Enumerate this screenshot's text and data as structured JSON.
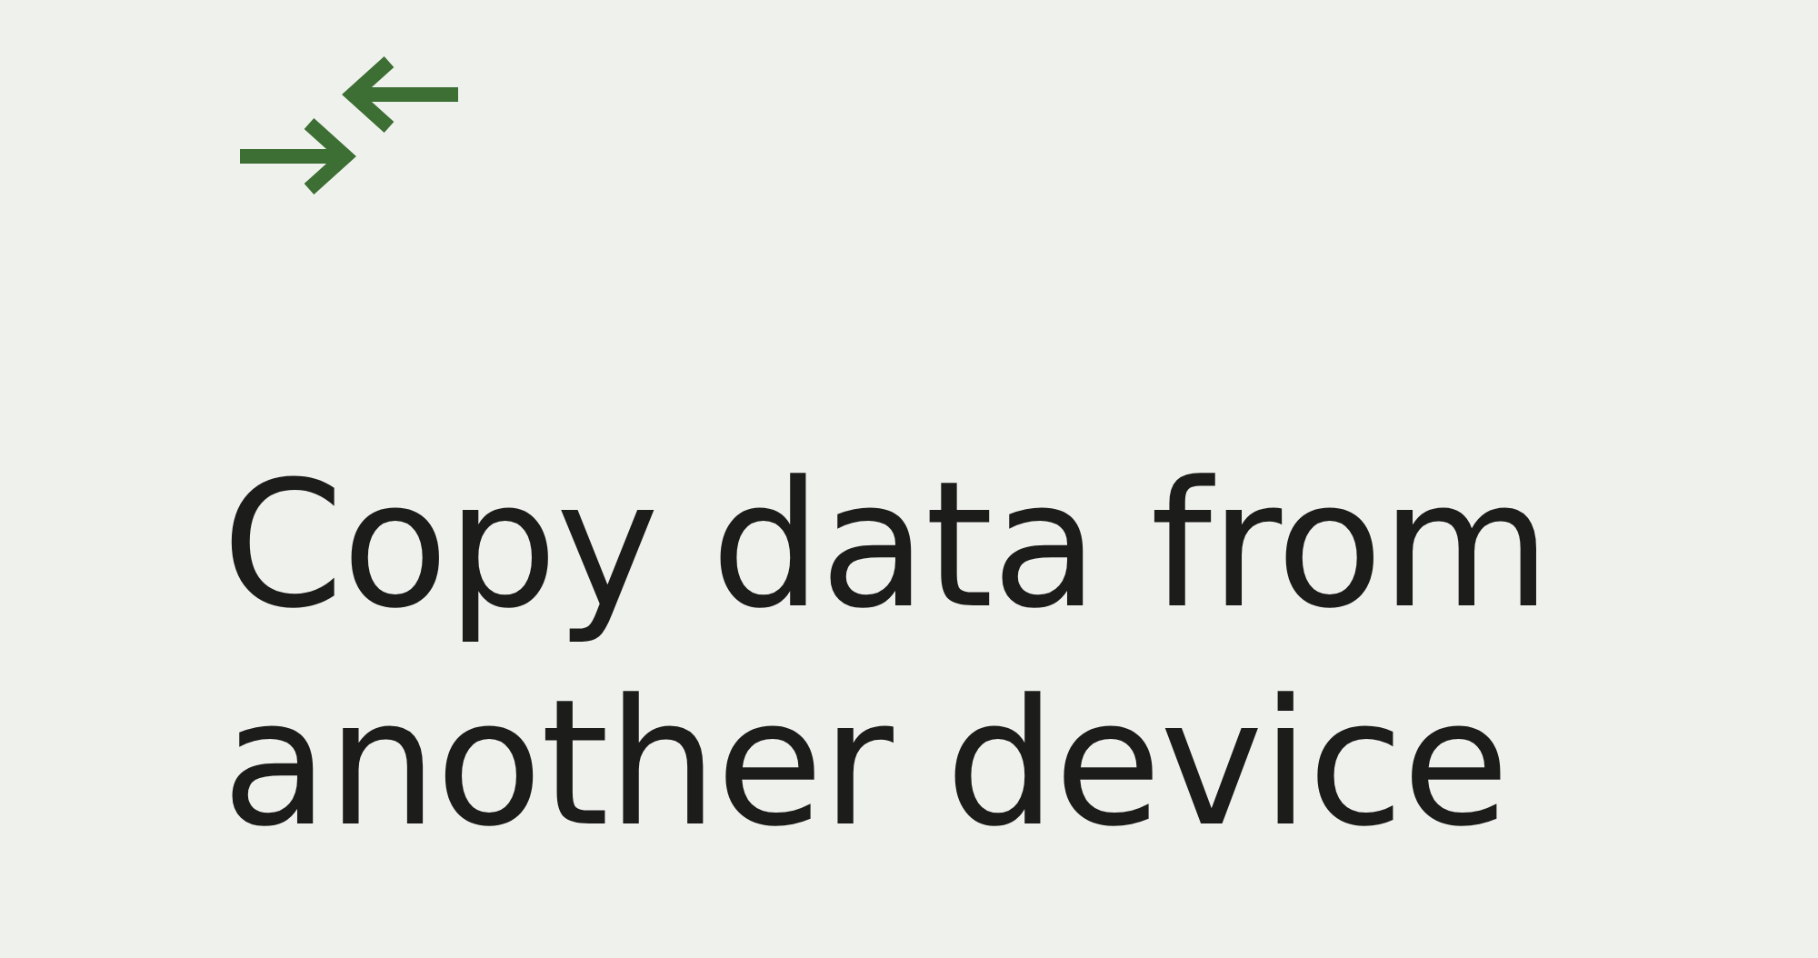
{
  "title": "Copy data from another device"
}
